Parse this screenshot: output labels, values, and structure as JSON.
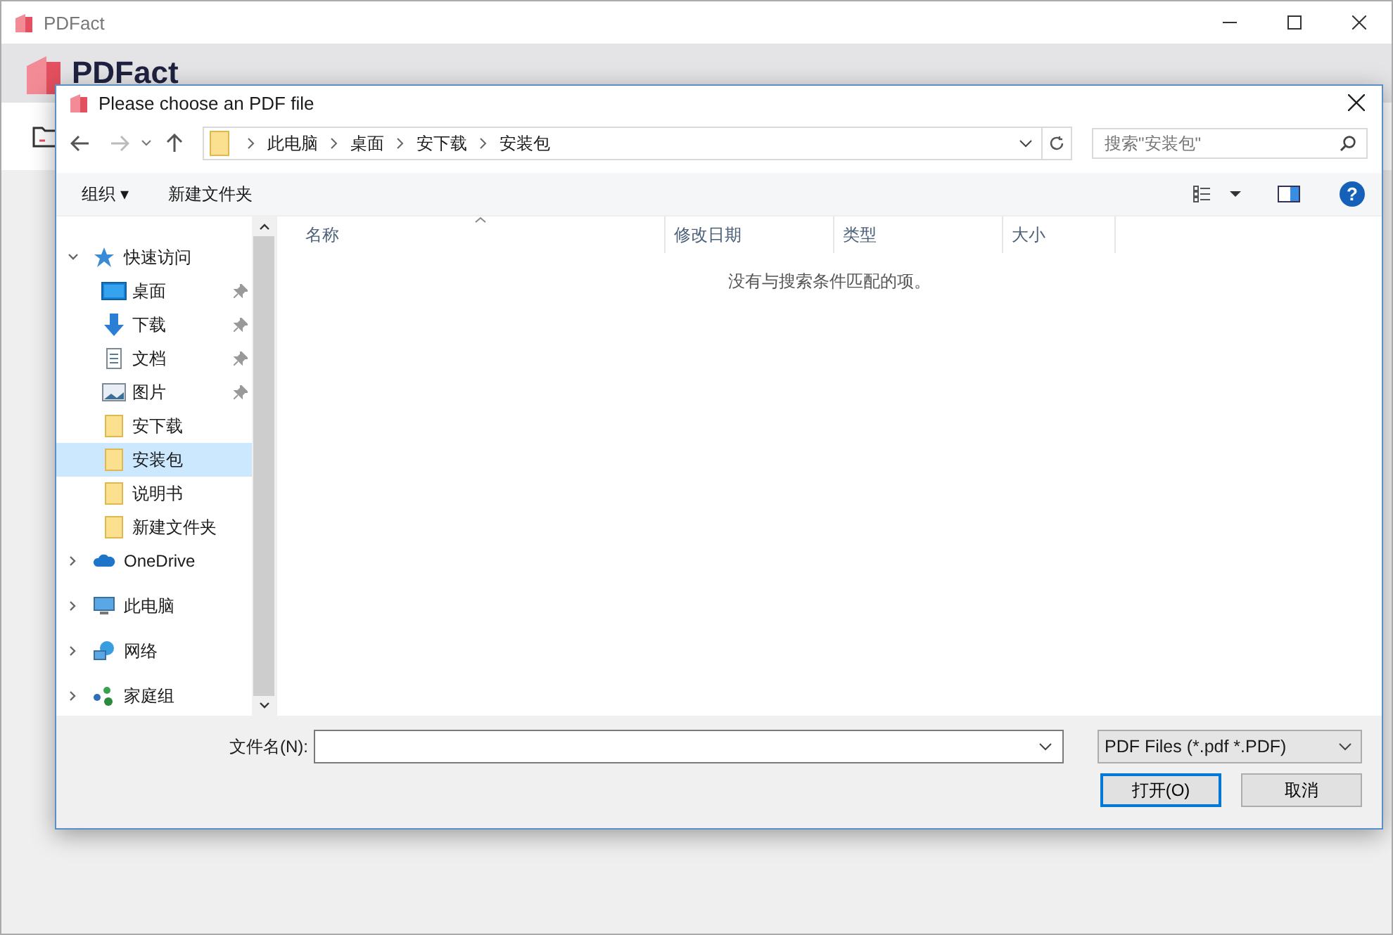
{
  "app": {
    "title": "PDFact",
    "logo_text": "PDFact"
  },
  "dialog": {
    "title": "Please choose an PDF file",
    "breadcrumb": [
      "此电脑",
      "桌面",
      "安下载",
      "安装包"
    ],
    "search": {
      "placeholder": "搜索\"安装包\""
    },
    "toolbar": {
      "organize": "组织 ▾",
      "new_folder": "新建文件夹",
      "help": "?"
    },
    "nav": [
      {
        "label": "快速访问",
        "kind": "star",
        "expanded": true,
        "children": [
          {
            "label": "桌面",
            "kind": "desktop",
            "pinned": true,
            "selected": false
          },
          {
            "label": "下载",
            "kind": "download",
            "pinned": true,
            "selected": false
          },
          {
            "label": "文档",
            "kind": "document",
            "pinned": true,
            "selected": false
          },
          {
            "label": "图片",
            "kind": "picture",
            "pinned": true,
            "selected": false
          },
          {
            "label": "安下载",
            "kind": "folder",
            "pinned": false,
            "selected": false
          },
          {
            "label": "安装包",
            "kind": "folder",
            "pinned": false,
            "selected": true
          },
          {
            "label": "说明书",
            "kind": "folder",
            "pinned": false,
            "selected": false
          },
          {
            "label": "新建文件夹",
            "kind": "folder",
            "pinned": false,
            "selected": false
          }
        ]
      },
      {
        "label": "OneDrive",
        "kind": "cloud",
        "expanded": false
      },
      {
        "label": "此电脑",
        "kind": "computer",
        "expanded": false
      },
      {
        "label": "网络",
        "kind": "network",
        "expanded": false
      },
      {
        "label": "家庭组",
        "kind": "homegroup",
        "expanded": false
      }
    ],
    "columns": [
      "名称",
      "修改日期",
      "类型",
      "大小"
    ],
    "empty_message": "没有与搜索条件匹配的项。",
    "filename_label": "文件名(N):",
    "file_type": "PDF Files (*.pdf *.PDF)",
    "buttons": [
      {
        "label": "打开(O)",
        "default": true
      },
      {
        "label": "取消",
        "default": false
      }
    ]
  }
}
